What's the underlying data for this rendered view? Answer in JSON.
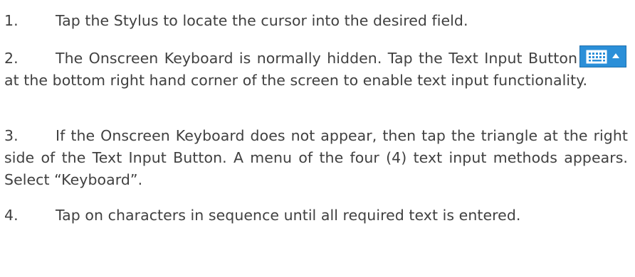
{
  "steps": [
    {
      "number": "1.",
      "text": "Tap the Stylus to locate the cursor into the desired field."
    },
    {
      "number": "2.",
      "text_before": "The Onscreen Keyboard is normally hidden. Tap the Text Input Button",
      "text_after": "at the bottom right hand corner of the screen to enable text input functionality."
    },
    {
      "number": "3.",
      "text": "If the Onscreen Keyboard does not appear, then tap the triangle at the right side of the Text Input Button. A menu of the four (4) text input methods appears. Select “Keyboard”."
    },
    {
      "number": "4.",
      "text": "Tap on characters in sequence until all required text is entered."
    }
  ],
  "colors": {
    "text": "#404040",
    "button_blue": "#2b8fd8"
  },
  "icons": {
    "keyboard": "keyboard-icon",
    "triangle": "triangle-up-icon"
  }
}
